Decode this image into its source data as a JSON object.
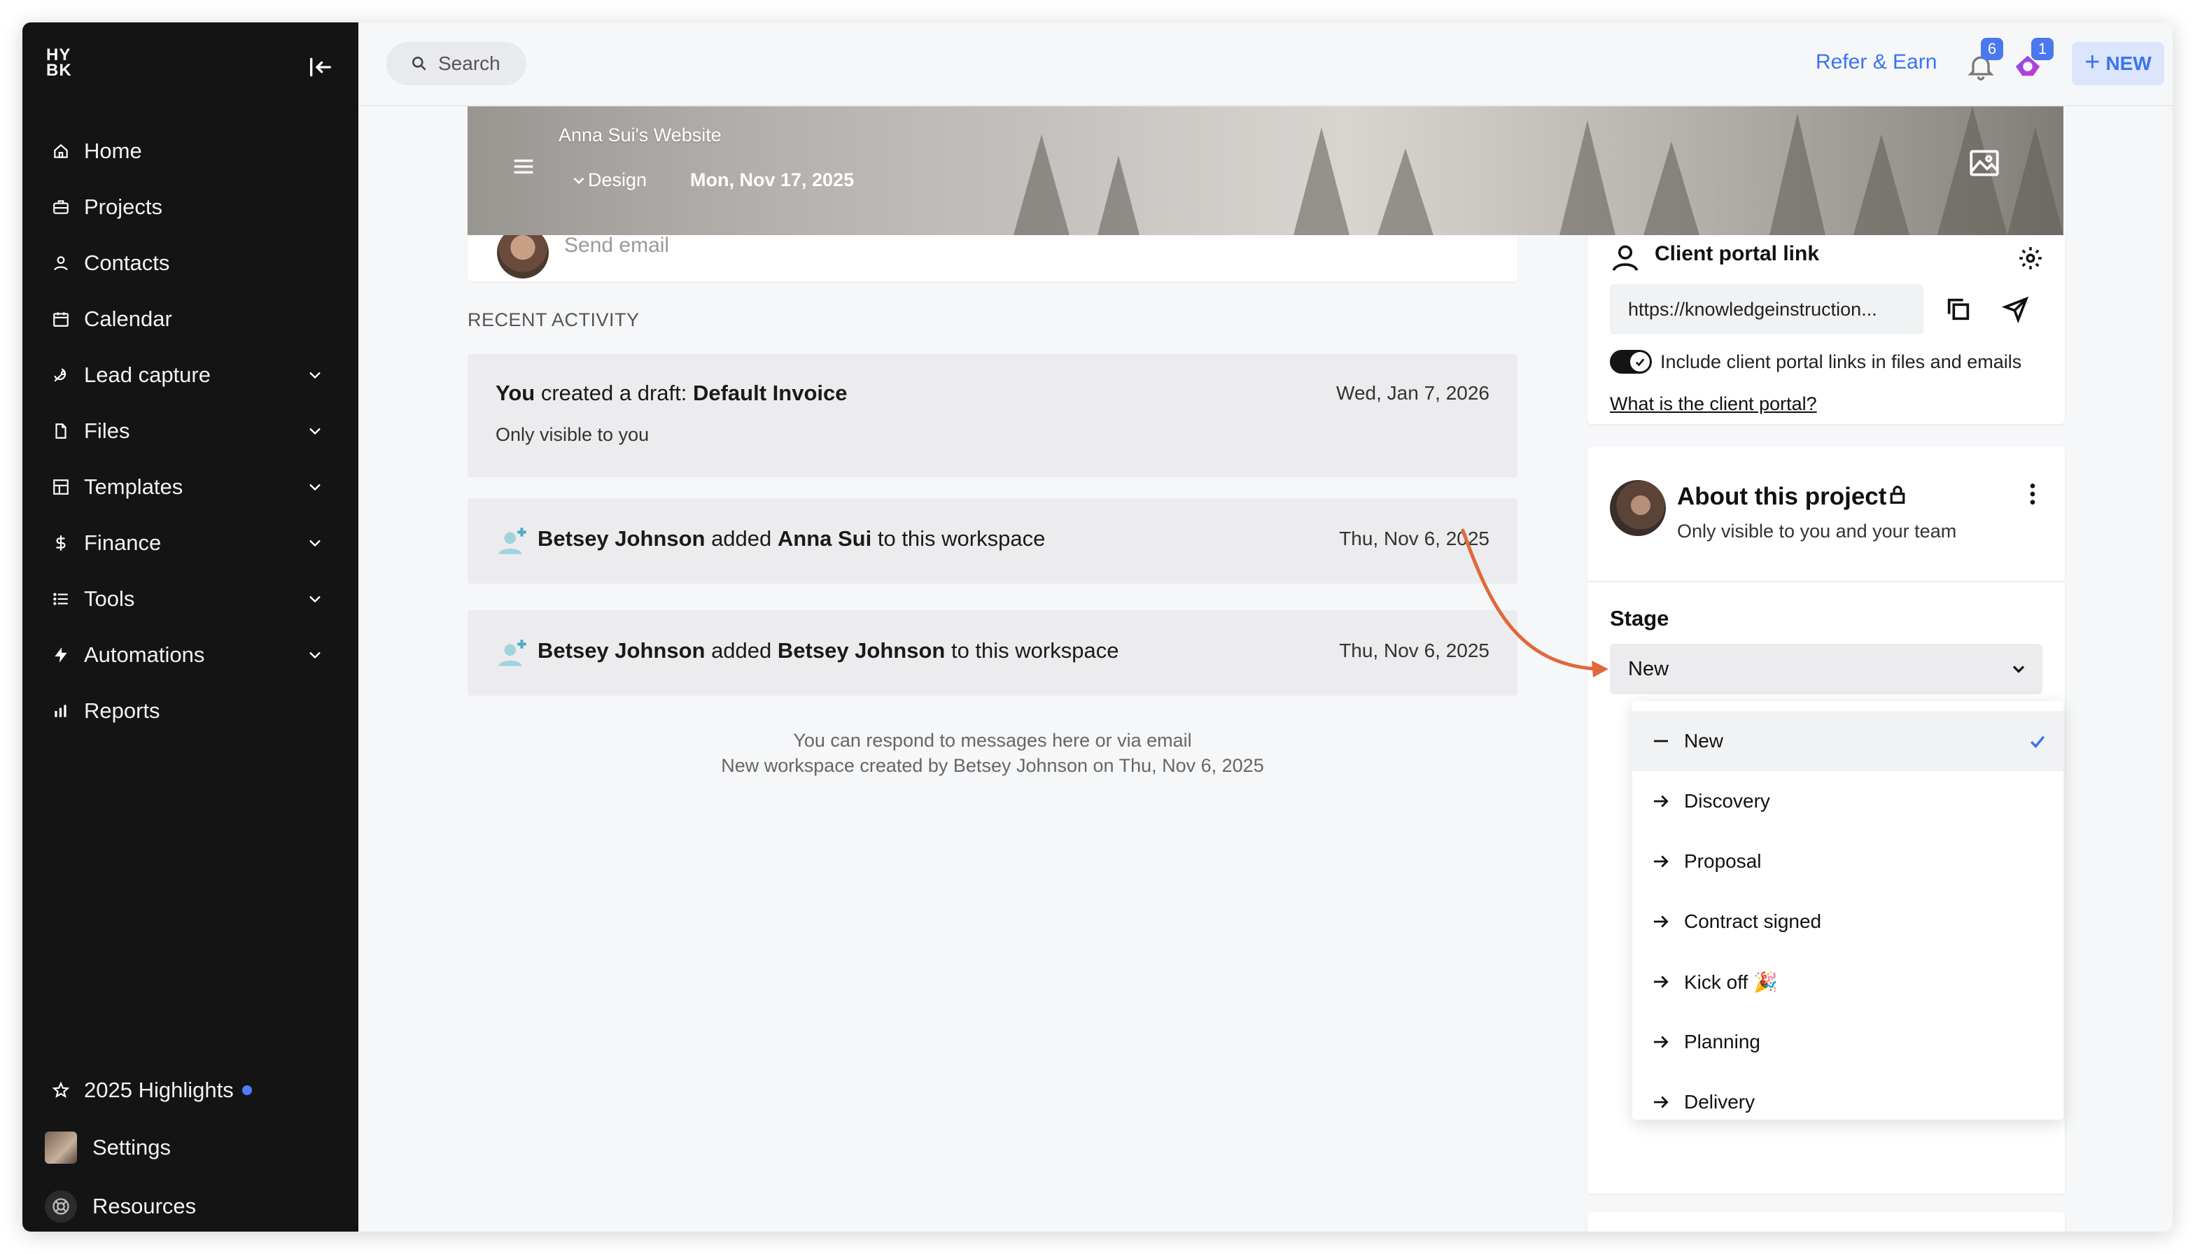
{
  "sidebar": {
    "logo": "HY BK",
    "items": [
      {
        "label": "Home",
        "icon": "home-icon"
      },
      {
        "label": "Projects",
        "icon": "briefcase-icon"
      },
      {
        "label": "Contacts",
        "icon": "user-icon"
      },
      {
        "label": "Calendar",
        "icon": "calendar-icon"
      },
      {
        "label": "Lead capture",
        "icon": "lead-capture-icon",
        "expandable": true
      },
      {
        "label": "Files",
        "icon": "file-icon",
        "expandable": true
      },
      {
        "label": "Templates",
        "icon": "templates-icon",
        "expandable": true
      },
      {
        "label": "Finance",
        "icon": "dollar-icon",
        "expandable": true
      },
      {
        "label": "Tools",
        "icon": "list-icon",
        "expandable": true
      },
      {
        "label": "Automations",
        "icon": "lightning-icon",
        "expandable": true
      },
      {
        "label": "Reports",
        "icon": "bar-chart-icon"
      }
    ],
    "bottom": [
      {
        "label": "2025 Highlights",
        "icon": "star-icon"
      },
      {
        "label": "Settings",
        "icon": "avatar"
      },
      {
        "label": "Resources",
        "icon": "lifebuoy-icon"
      }
    ]
  },
  "topbar": {
    "search_label": "Search",
    "refer_label": "Refer & Earn",
    "notifications_count": "6",
    "messages_count": "1",
    "new_label": "NEW"
  },
  "banner": {
    "title": "Anna Sui's Website",
    "type": "Design",
    "date": "Mon, Nov 17, 2025"
  },
  "send_email": "Send email",
  "recent": {
    "section_label": "RECENT ACTIVITY",
    "items": [
      {
        "actor": "You",
        "verb": " created a draft: ",
        "object": "Default Invoice",
        "tail": "",
        "sub": "Only visible to you",
        "date": "Wed, Jan 7, 2026"
      },
      {
        "actor": "Betsey Johnson",
        "verb": " added ",
        "object": "Anna Sui",
        "tail": " to this workspace",
        "date": "Thu, Nov 6, 2025"
      },
      {
        "actor": "Betsey Johnson",
        "verb": " added ",
        "object": "Betsey Johnson",
        "tail": " to this workspace",
        "date": "Thu, Nov 6, 2025"
      }
    ],
    "footnote_1": "You can respond to messages here or via email",
    "footnote_2": "New workspace created by Betsey Johnson on Thu, Nov 6, 2025"
  },
  "client_portal": {
    "title": "Client portal link",
    "url": "https://knowledgeinstruction...",
    "toggle_label": "Include client portal links in files and emails",
    "toggle_on": true,
    "help_link": "What is the client portal?"
  },
  "about": {
    "title": "About this project",
    "subtitle": "Only visible to you and your team",
    "stage_label": "Stage",
    "stage_value": "New",
    "options": [
      {
        "label": "New",
        "selected": true
      },
      {
        "label": "Discovery"
      },
      {
        "label": "Proposal"
      },
      {
        "label": "Contract signed"
      },
      {
        "label": "Kick off 🎉"
      },
      {
        "label": "Planning"
      },
      {
        "label": "Delivery"
      }
    ]
  },
  "colors": {
    "accent": "#3b73ef",
    "sidebar_bg": "#141414",
    "annotation_arrow": "#e0683a"
  }
}
